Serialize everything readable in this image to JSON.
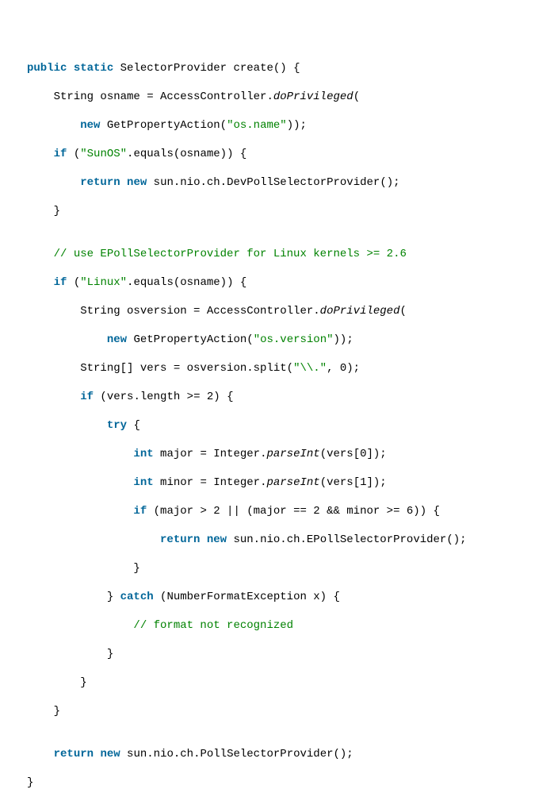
{
  "code": {
    "l1": {
      "kw1": "public",
      "kw2": "static",
      "t3": " SelectorProvider create() {"
    },
    "l2": {
      "t1": "    String osname = AccessController.",
      "m": "doPrivileged",
      "t2": "("
    },
    "l3": {
      "t1": "        ",
      "kw": "new",
      "t2": " GetPropertyAction(",
      "s": "\"os.name\"",
      "t3": "));"
    },
    "l4": {
      "t1": "    ",
      "kw": "if",
      "t2": " (",
      "s": "\"SunOS\"",
      "t3": ".equals(osname)) {"
    },
    "l5": {
      "t1": "        ",
      "kw1": "return",
      "kw2": "new",
      "t3": " sun.nio.ch.DevPollSelectorProvider();"
    },
    "l6": {
      "t": "    }"
    },
    "l7": {
      "t": ""
    },
    "l8": {
      "t1": "    ",
      "c": "// use EPollSelectorProvider for Linux kernels >= 2.6"
    },
    "l9": {
      "t1": "    ",
      "kw": "if",
      "t2": " (",
      "s": "\"Linux\"",
      "t3": ".equals(osname)) {"
    },
    "l10": {
      "t1": "        String osversion = AccessController.",
      "m": "doPrivileged",
      "t2": "("
    },
    "l11": {
      "t1": "            ",
      "kw": "new",
      "t2": " GetPropertyAction(",
      "s": "\"os.version\"",
      "t3": "));"
    },
    "l12": {
      "t1": "        String[] vers = osversion.split(",
      "s": "\"\\\\.\"",
      "t2": ", 0);"
    },
    "l13": {
      "t1": "        ",
      "kw": "if",
      "t2": " (vers.",
      "p": "length",
      "t3": " >= 2) {"
    },
    "l14": {
      "t1": "            ",
      "kw": "try",
      "t2": " {"
    },
    "l15": {
      "t1": "                ",
      "kw": "int",
      "t2": " major = Integer.",
      "m": "parseInt",
      "t3": "(vers[0]);"
    },
    "l16": {
      "t1": "                ",
      "kw": "int",
      "t2": " minor = Integer.",
      "m": "parseInt",
      "t3": "(vers[1]);"
    },
    "l17": {
      "t1": "                ",
      "kw": "if",
      "t2": " (major > 2 || (major == 2 && minor >= 6)) {"
    },
    "l18": {
      "t1": "                    ",
      "kw1": "return",
      "kw2": "new",
      "t3": " sun.nio.ch.EPollSelectorProvider();"
    },
    "l19": {
      "t": "                }"
    },
    "l20": {
      "t1": "            } ",
      "kw": "catch",
      "t2": " (NumberFormatException x) {"
    },
    "l21": {
      "t1": "                ",
      "c": "// format not recognized"
    },
    "l22": {
      "t": "            }"
    },
    "l23": {
      "t": "        }"
    },
    "l24": {
      "t": "    }"
    },
    "l25": {
      "t": ""
    },
    "l26": {
      "t1": "    ",
      "kw1": "return",
      "kw2": "new",
      "t3": " sun.nio.ch.PollSelectorProvider();"
    },
    "l27": {
      "t": "}"
    }
  }
}
